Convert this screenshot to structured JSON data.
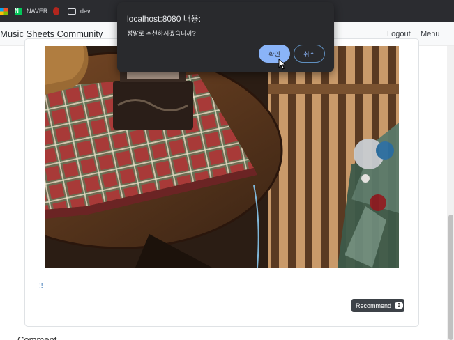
{
  "bookmarks": {
    "items": [
      {
        "label": ""
      },
      {
        "label": "NAVER",
        "icon_text": "N"
      },
      {
        "label": ""
      },
      {
        "label": "dev"
      }
    ]
  },
  "navbar": {
    "brand": "Music Sheets Community",
    "links": [
      "Logout",
      "Menu"
    ]
  },
  "post": {
    "text": "!!",
    "recommend_label": "Recommend",
    "recommend_count": "0"
  },
  "comment": {
    "heading": "Comment"
  },
  "dialog": {
    "title": "localhost:8080 내용:",
    "message": "정말로 추천하시겠습니까?",
    "ok_label": "확인",
    "cancel_label": "취소"
  },
  "colors": {
    "dialog_bg": "#292a2d",
    "ok_button": "#8ab4f8",
    "link": "#2b6cb0"
  }
}
